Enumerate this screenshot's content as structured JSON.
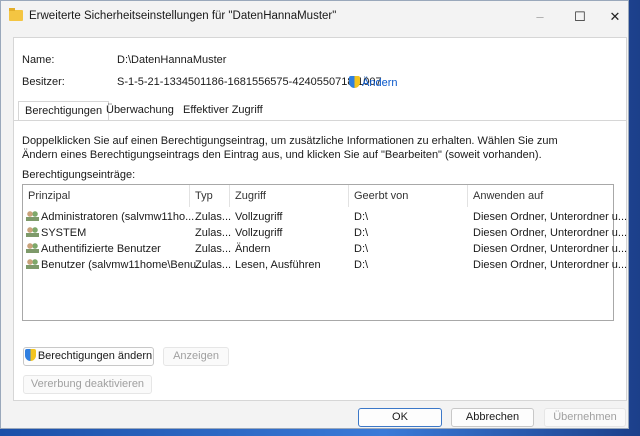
{
  "window": {
    "title": "Erweiterte Sicherheitseinstellungen für \"DatenHannaMuster\"",
    "minimize": "–",
    "maximize": "☐",
    "close": "✕"
  },
  "name_label": "Name:",
  "name_value": "D:\\DatenHannaMuster",
  "owner_label": "Besitzer:",
  "owner_value": "S-1-5-21-1334501186-1681556575-4240550718-1007",
  "owner_change": "Ändern",
  "tabs": [
    {
      "label": "Berechtigungen",
      "active": true
    },
    {
      "label": "Überwachung"
    },
    {
      "label": "Effektiver Zugriff"
    }
  ],
  "description": "Doppelklicken Sie auf einen Berechtigungseintrag, um zusätzliche Informationen zu erhalten. Wählen Sie zum Ändern eines Berechtigungseintrags den Eintrag aus, und klicken Sie auf \"Bearbeiten\" (soweit vorhanden).",
  "entries_label": "Berechtigungseinträge:",
  "columns": [
    "Prinzipal",
    "Typ",
    "Zugriff",
    "Geerbt von",
    "Anwenden auf"
  ],
  "rows": [
    [
      "Administratoren (salvmw11ho...",
      "Zulas...",
      "Vollzugriff",
      "D:\\",
      "Diesen Ordner, Unterordner u..."
    ],
    [
      "SYSTEM",
      "Zulas...",
      "Vollzugriff",
      "D:\\",
      "Diesen Ordner, Unterordner u..."
    ],
    [
      "Authentifizierte Benutzer",
      "Zulas...",
      "Ändern",
      "D:\\",
      "Diesen Ordner, Unterordner u..."
    ],
    [
      "Benutzer (salvmw11home\\Benu...",
      "Zulas...",
      "Lesen, Ausführen",
      "D:\\",
      "Diesen Ordner, Unterordner u..."
    ]
  ],
  "buttons": {
    "change_permissions": "Berechtigungen ändern",
    "view": "Anzeigen",
    "disable_inheritance": "Vererbung deaktivieren",
    "ok": "OK",
    "cancel": "Abbrechen",
    "apply": "Übernehmen"
  }
}
